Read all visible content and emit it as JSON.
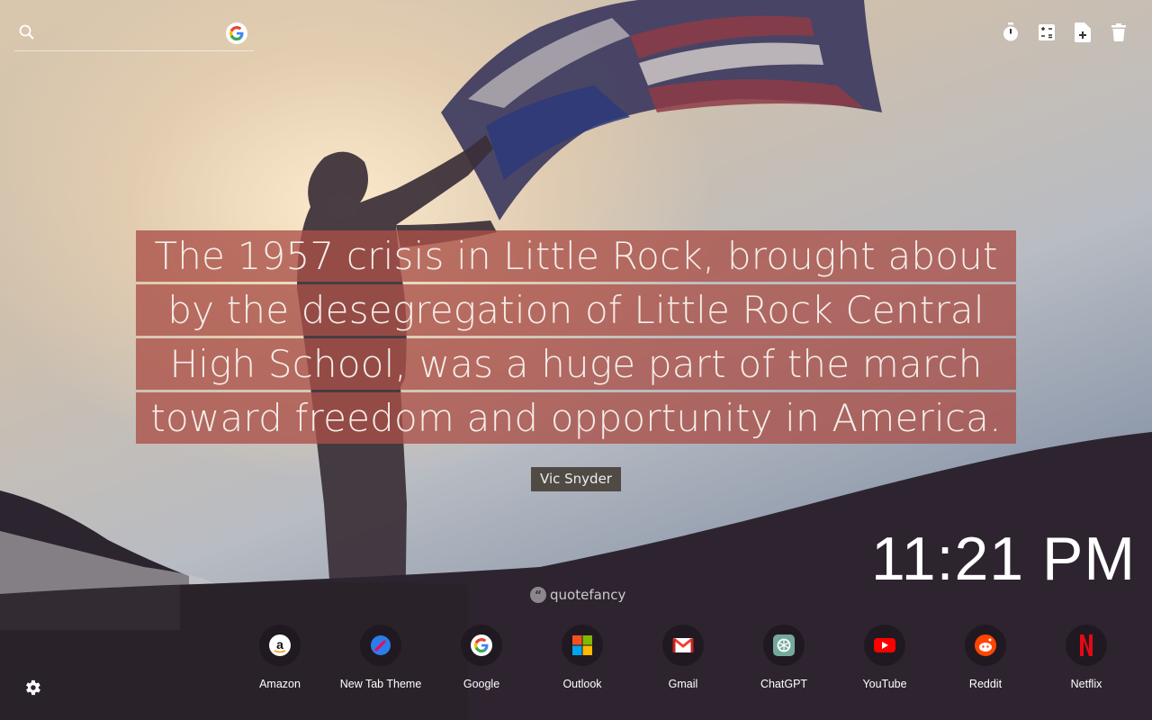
{
  "search": {
    "placeholder": "",
    "engine_icon": "google-icon"
  },
  "tools": [
    {
      "name": "timer-icon"
    },
    {
      "name": "calculator-icon"
    },
    {
      "name": "new-note-icon"
    },
    {
      "name": "trash-icon"
    }
  ],
  "quote": {
    "lines": [
      "The 1957 crisis in Little Rock, brought about",
      "by the desegregation of Little Rock Central",
      "High School, was a huge part of the march",
      "toward freedom and opportunity in America."
    ],
    "author": "Vic Snyder",
    "source": "quotefancy"
  },
  "clock": {
    "time": "11:21 PM"
  },
  "shortcuts": [
    {
      "label": "Amazon",
      "icon": "amazon-icon"
    },
    {
      "label": "New Tab Theme",
      "icon": "new-tab-theme-icon"
    },
    {
      "label": "Google",
      "icon": "google-icon"
    },
    {
      "label": "Outlook",
      "icon": "outlook-icon"
    },
    {
      "label": "Gmail",
      "icon": "gmail-icon"
    },
    {
      "label": "ChatGPT",
      "icon": "chatgpt-icon"
    },
    {
      "label": "YouTube",
      "icon": "youtube-icon"
    },
    {
      "label": "Reddit",
      "icon": "reddit-icon"
    },
    {
      "label": "Netflix",
      "icon": "netflix-icon"
    }
  ],
  "colors": {
    "quote_bg": "#aa5048",
    "author_bg": "#463e37",
    "hill": "#2e2430"
  }
}
